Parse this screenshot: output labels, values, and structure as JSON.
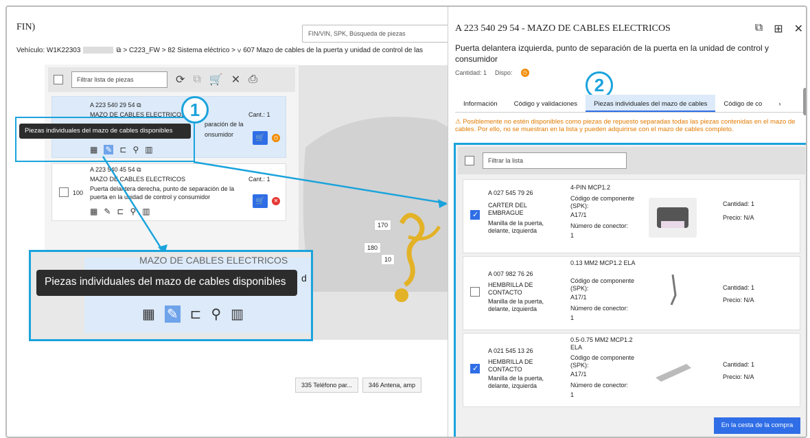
{
  "left": {
    "fin_label": "FIN)",
    "search_placeholder": "FIN/VIN, SPK, Búsqueda de piezas",
    "breadcrumb_prefix": "Vehículo: W1K22303",
    "breadcrumb_rest": "⧉ > C223_FW > 82 Sistema eléctrico > ∨ 607 Mazo de cables de la puerta y unidad de control de las",
    "filter_placeholder": "Filtrar lista de piezas",
    "tooltip": "Piezas individuales del mazo de cables disponibles",
    "items": [
      {
        "number": "A 223 540 29 54 ⧉",
        "name": "MAZO DE CABLES ELECTRICOS",
        "desc_a": "paración de la",
        "desc_b": "onsumidor",
        "qty": "Cant.: 1",
        "status_icon": "clock-icon"
      },
      {
        "number": "A 223 540 45 54 ⧉",
        "name": "MAZO DE CABLES ELECTRICOS",
        "index": "100",
        "desc": "Puerta delantera derecha, punto de separación de la puerta en la unidad de control y consumidor",
        "qty": "Cant.: 1",
        "status_icon": "cross-icon"
      }
    ],
    "badge1": "1",
    "zoom_bg_title": "MAZO DE CABLES ELECTRICOS",
    "zoom_bg_letter": "d",
    "zoom_tooltip": "Piezas individuales del mazo de cables disponibles",
    "diagram_labels": [
      "170",
      "180",
      "10"
    ],
    "bottom_tabs": [
      "335 Teléfono par...",
      "346 Antena, amp"
    ]
  },
  "right": {
    "title": "A 223 540 29 54 - MAZO DE CABLES ELECTRICOS",
    "description": "Puerta delantera izquierda, punto de separación de la puerta en la unidad de control y consumidor",
    "qty_label": "Cantidad:  1",
    "dispo_label": "Dispo:",
    "badge2": "2",
    "tabs": [
      "Información",
      "Código y validaciones",
      "Piezas individuales del mazo de cables",
      "Código de co"
    ],
    "warning": "Posiblemente no estén disponibles como piezas de repuesto separadas todas las piezas contenidas en el mazo de cables. Por ello, no se muestran en la lista y pueden adquirirse con el mazo de cables completo.",
    "filter_placeholder": "Filtrar la lista",
    "parts": [
      {
        "number": "A 027 545 79 26",
        "name": "CARTER DEL EMBRAGUE",
        "location": "Manilla de la puerta, delante, izquierda",
        "spec": "4-PIN MCP1.2",
        "spk_label": "Código de componente (SPK):",
        "spk": "A17/1",
        "conn_label": "Número de conector:",
        "conn": "1",
        "qty": "Cantidad: 1",
        "price": "Precio: N/A",
        "checked": true
      },
      {
        "number": "A 007 982 76 26",
        "name": "HEMBRILLA DE CONTACTO",
        "location": "Manilla de la puerta, delante, izquierda",
        "spec": "0.13 MM2 MCP1.2 ELA",
        "spk_label": "Código de componente (SPK):",
        "spk": "A17/1",
        "conn_label": "Número de conector:",
        "conn": "1",
        "qty": "Cantidad: 1",
        "price": "Precio: N/A",
        "checked": false
      },
      {
        "number": "A 021 545 13 26",
        "name": "HEMBRILLA DE CONTACTO",
        "location": "Manilla de la puerta, delante, izquierda",
        "spec": "0.5-0.75 MM2 MCP1.2 ELA",
        "spk_label": "Código de componente (SPK):",
        "spk": "A17/1",
        "conn_label": "Número de conector:",
        "conn": "1",
        "qty": "Cantidad: 1",
        "price": "Precio: N/A",
        "checked": true
      }
    ],
    "add_to_cart": "En la cesta de la compra"
  },
  "colors": {
    "accent": "#2f6ee6",
    "highlight": "#1aa3dc",
    "warning": "#e07a00",
    "error": "#e53935",
    "pending": "#f08a00"
  }
}
